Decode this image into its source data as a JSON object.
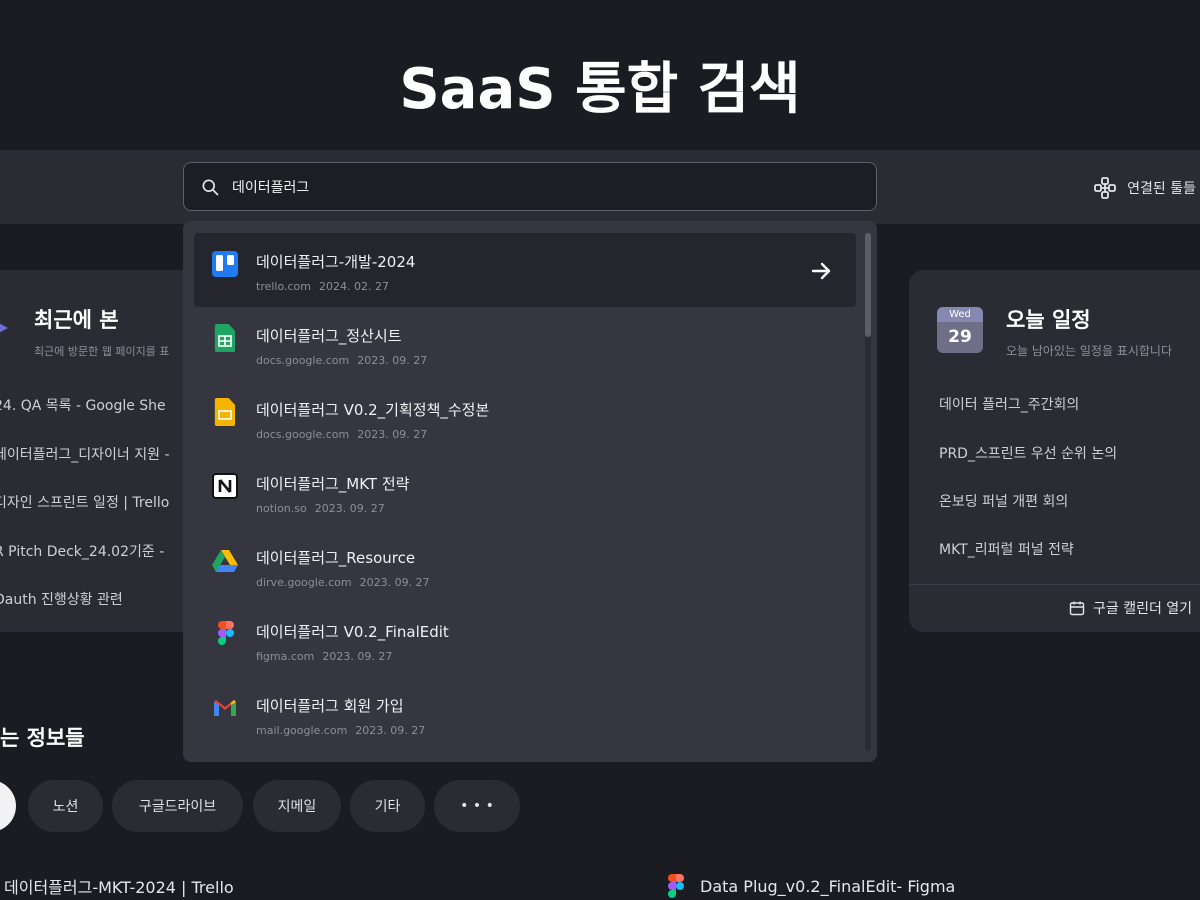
{
  "hero": {
    "title": "SaaS 통합 검색"
  },
  "topbar": {
    "connected_label": "연결된 툴들"
  },
  "search": {
    "value": "데이터플러그"
  },
  "recent": {
    "title": "최근에 본",
    "subtitle": "최근에 방문한 웹 페이지를 표",
    "items": [
      "24. QA  목록 - Google She",
      "데이터플러그_디자이너 지원 -",
      "디자인 스프린트 일정 | Trello",
      "R Pitch Deck_24.02기준 -",
      "Dauth 진행상황 관련"
    ]
  },
  "schedule": {
    "badge_dow": "Wed",
    "badge_day": "29",
    "title": "오늘 일정",
    "subtitle": "오늘 남아있는 일정을 표시합니다",
    "items": [
      "데이터 플러그_주간회의",
      "PRD_스프린트 우선 순위 논의",
      "온보딩 퍼널 개편 회의",
      "MKT_리퍼럴 퍼널 전략"
    ],
    "open_calendar": "구글 캘린더 열기"
  },
  "info": {
    "title": "는 정보들",
    "chips": [
      "노션",
      "구글드라이브",
      "지메일",
      "기타",
      "• • •"
    ]
  },
  "bottom": {
    "left": "데이터플러그-MKT-2024 | Trello",
    "right": "Data Plug_v0.2_FinalEdit- Figma"
  },
  "results": [
    {
      "title": "데이터플러그-개발-2024",
      "domain": "trello.com",
      "date": "2024. 02. 27",
      "icon": "trello-icon"
    },
    {
      "title": "데이터플러그_정산시트",
      "domain": "docs.google.com",
      "date": "2023. 09. 27",
      "icon": "google-sheets-icon"
    },
    {
      "title": "데이터플러그 V0.2_기획정책_수정본",
      "domain": "docs.google.com",
      "date": "2023. 09. 27",
      "icon": "google-slides-icon"
    },
    {
      "title": "데이터플러그_MKT 전략",
      "domain": "notion.so",
      "date": "2023. 09. 27",
      "icon": "notion-icon"
    },
    {
      "title": "데이터플러그_Resource",
      "domain": "dirve.google.com",
      "date": "2023. 09. 27",
      "icon": "google-drive-icon"
    },
    {
      "title": "데이터플러그 V0.2_FinalEdit",
      "domain": "figma.com",
      "date": "2023. 09. 27",
      "icon": "figma-icon"
    },
    {
      "title": "데이터플러그 회원 가입",
      "domain": "mail.google.com",
      "date": "2023. 09. 27",
      "icon": "gmail-icon"
    }
  ],
  "colors": {
    "background": "#1b1c22",
    "panel": "#2a2b33",
    "dropdown": "#35363f",
    "text": "#e9e9ee",
    "muted": "#8c8e98"
  }
}
